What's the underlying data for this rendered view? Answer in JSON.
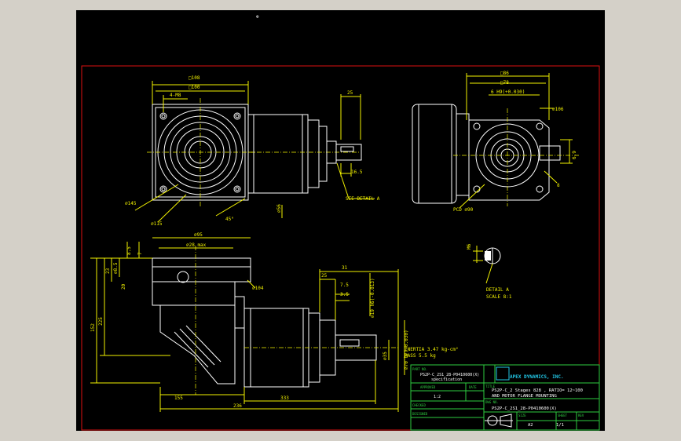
{
  "drawing": {
    "dims_top_left": [
      "□108",
      "□100",
      "4-M8",
      "⌀145",
      "⌀115",
      "45°",
      "⌀56"
    ],
    "dims_top_shaft": [
      "25",
      "16.5",
      "SEE DETAIL A"
    ],
    "dims_top_right": [
      "□86",
      "□78",
      "6 H9(+0.030)",
      "⌀106",
      "PCD ⌀90",
      "8",
      "6.9"
    ],
    "dims_front": [
      "⌀95",
      "⌀28 max",
      "8.5",
      "7",
      "23",
      "⌀8.5",
      "20",
      "⌀104",
      "225",
      "152",
      "155",
      "333",
      "236"
    ],
    "dims_side": [
      "31",
      "25",
      "7.5",
      "3.5",
      "⌀19 h6(-0.013)",
      "⌀35",
      "⌀70 h7(-0.030)"
    ],
    "detail": {
      "dim": "M6",
      "label": "DETAIL A",
      "scale": "SCALE 8:1"
    },
    "notes": [
      "INERTIA  3.47 kg-cm²",
      "MASS 5.5 kg"
    ],
    "center_mark": "⊕"
  },
  "title_block": {
    "company": "APEX DYNAMICS, INC.",
    "part_no_label": "PART NO.",
    "part_no": "PS2P-C_2S1_28-P0410600(X)",
    "spec": "specification",
    "approved_label": "APPROVED",
    "approved_date": "DATE",
    "checked_label": "CHECKED",
    "designed_label": "DESIGNED",
    "scale_val": "1:2",
    "title_label": "TITLE",
    "title_line1": "PS2P-C_2 Stages 828 , RATIO= 12~100",
    "title_line2": "AND MOTOR FLANGE MOUNTING",
    "dwg_no_label": "DWG NO.",
    "dwg_no": "PS2P-C_2S1_28-P0410600(X)",
    "size_label": "SIZE",
    "size_val": "A2",
    "sheet_label": "SHEET",
    "sheet_val": "1/1",
    "rev_label": "REV"
  }
}
